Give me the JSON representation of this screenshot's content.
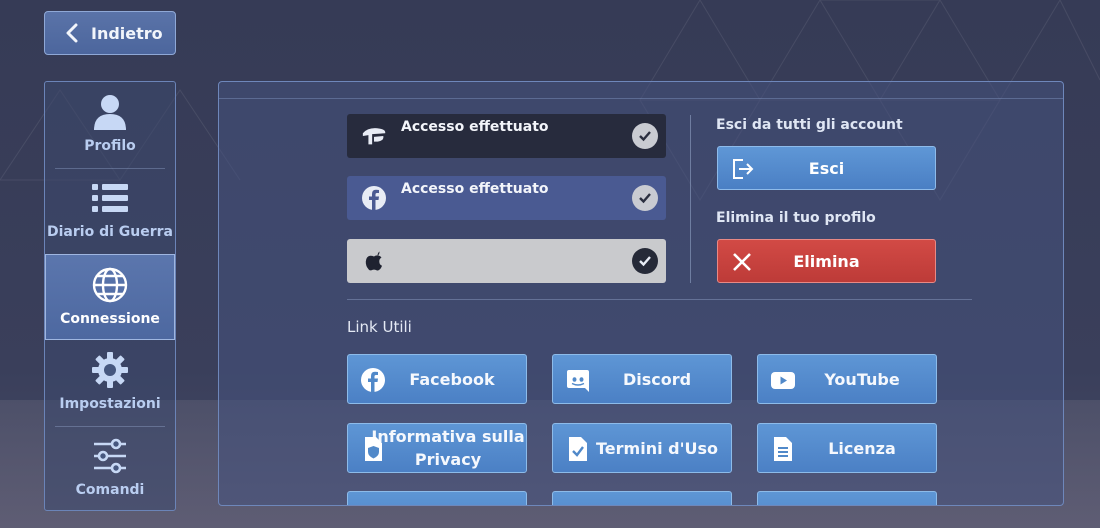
{
  "nav": {
    "back_label": "Indietro"
  },
  "sidebar": {
    "items": [
      {
        "label": "Profilo",
        "icon": "user-icon",
        "active": false
      },
      {
        "label": "Diario di Guerra",
        "icon": "list-icon",
        "active": false
      },
      {
        "label": "Connessione",
        "icon": "globe-icon",
        "active": true
      },
      {
        "label": "Impostazioni",
        "icon": "gear-icon",
        "active": false
      },
      {
        "label": "Comandi",
        "icon": "sliders-icon",
        "active": false
      }
    ]
  },
  "accounts": [
    {
      "provider_icon": "game-logo-icon",
      "status": "Accesso effettuato",
      "checked": true
    },
    {
      "provider_icon": "facebook-icon",
      "status": "Accesso effettuato",
      "checked": true
    },
    {
      "provider_icon": "apple-icon",
      "status": "",
      "checked": true
    }
  ],
  "logout": {
    "label": "Esci da tutti gli account",
    "button": "Esci"
  },
  "delete": {
    "label": "Elimina il tuo profilo",
    "button": "Elimina"
  },
  "links": {
    "title": "Link Utili",
    "items": [
      {
        "label": "Facebook",
        "icon": "facebook-icon"
      },
      {
        "label": "Discord",
        "icon": "discord-icon"
      },
      {
        "label": "YouTube",
        "icon": "youtube-icon"
      },
      {
        "label": "Informativa sulla Privacy",
        "icon": "privacy-shield-icon"
      },
      {
        "label": "Termini d'Uso",
        "icon": "document-check-icon"
      },
      {
        "label": "Licenza",
        "icon": "document-icon"
      }
    ]
  },
  "colors": {
    "accent_blue": "#4b80c5",
    "danger_red": "#bd3b38",
    "sidebar_active": "#4d68a0"
  }
}
